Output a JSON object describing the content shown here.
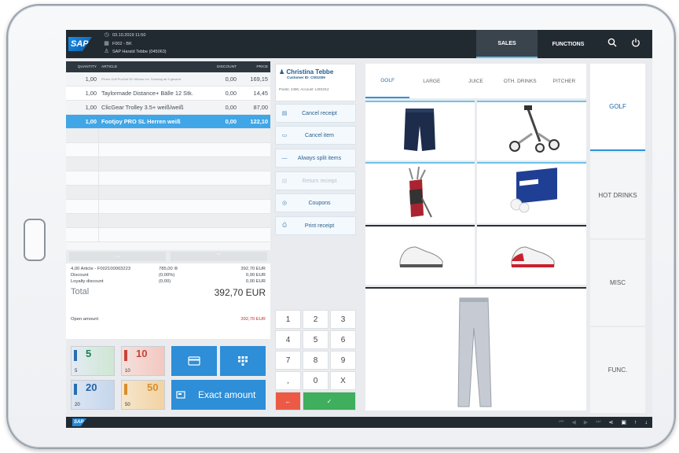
{
  "header": {
    "datetime": "03.10.2019 11:50",
    "store": "F002 - BK",
    "user": "SAP Harald Tebbe (045063)",
    "tabs": [
      {
        "label": "SALES",
        "active": true
      },
      {
        "label": "FUNCTIONS",
        "active": false
      }
    ],
    "logo": "SAP"
  },
  "receipt": {
    "columns": [
      "QUANTITY",
      "ARTICLE",
      "DISCOUNT",
      "PRICE"
    ],
    "rows": [
      {
        "qty": "1,00",
        "article": "Pinion Golf ProGolf 50 Yellows Inc. Sonntag ab 5 gesamt",
        "discount": "0,00",
        "price": "169,15",
        "small": true
      },
      {
        "qty": "1,00",
        "article": "Taylormade Distance+ Bälle 12 Stk.",
        "discount": "0,00",
        "price": "14,45"
      },
      {
        "qty": "1,00",
        "article": "ClicGear Trolley 3.5+ weiß/weiß",
        "discount": "0,00",
        "price": "87,00"
      },
      {
        "qty": "1,00",
        "article": "Footjoy PRO SL Herren weiß",
        "discount": "0,00",
        "price": "122,10",
        "selected": true
      }
    ]
  },
  "totals": {
    "article_line": "4,00 Article - F002100003223",
    "article_mid": "785,00",
    "article_amount": "392,70 EUR",
    "discount_label": "Discount",
    "discount_mid": "(0,00%)",
    "discount_amount": "0,00 EUR",
    "loyalty_label": "Loyalty discount",
    "loyalty_mid": "(0,00)",
    "loyalty_amount": "0,00 EUR",
    "total_label": "Total",
    "total_amount": "392,70 EUR",
    "open_label": "Open amount",
    "open_amount": "392,70 EUR"
  },
  "payment": {
    "notes": [
      {
        "value": "5"
      },
      {
        "value": "10"
      },
      {
        "value": "20"
      },
      {
        "value": "50"
      }
    ],
    "exact_label": "Exact amount"
  },
  "customer": {
    "name": "Christina Tebbe",
    "id": "Customer ID: C001009",
    "points": "Points: 2490, Account: L001012"
  },
  "actions": [
    {
      "label": "Cancel receipt",
      "icon": "receipt-cancel-icon",
      "disabled": false
    },
    {
      "label": "Cancel item",
      "icon": "item-cancel-icon",
      "disabled": false
    },
    {
      "label": "Always split items",
      "icon": "split-icon",
      "disabled": false
    },
    {
      "label": "Return receipt",
      "icon": "return-icon",
      "disabled": true
    },
    {
      "label": "Coupons",
      "icon": "coupon-icon",
      "disabled": false
    },
    {
      "label": "Print receipt",
      "icon": "printer-icon",
      "disabled": false
    }
  ],
  "keypad": [
    "1",
    "2",
    "3",
    "4",
    "5",
    "6",
    "7",
    "8",
    "9",
    ",",
    "0",
    "X"
  ],
  "product_tabs": [
    {
      "label": "GOLF",
      "active": true
    },
    {
      "label": "LARGE",
      "active": false
    },
    {
      "label": "JUICE",
      "active": false
    },
    {
      "label": "OTH. DRINKS",
      "active": false
    },
    {
      "label": "PITCHER",
      "active": false
    }
  ],
  "products": [
    "golf-shorts",
    "golf-trolley",
    "golf-bag",
    "golf-balls",
    "golf-shoe-white",
    "golf-shoe-red",
    "golf-trousers"
  ],
  "right_categories": [
    {
      "label": "GOLF",
      "active": true
    },
    {
      "label": "HOT DRINKS",
      "active": false
    },
    {
      "label": "MISC",
      "active": false
    },
    {
      "label": "FUNC.",
      "active": false
    }
  ],
  "colors": {
    "accent": "#2e8ed7",
    "selected_row": "#40a6e7",
    "header": "#222a31",
    "open_amount": "#c3312b"
  }
}
